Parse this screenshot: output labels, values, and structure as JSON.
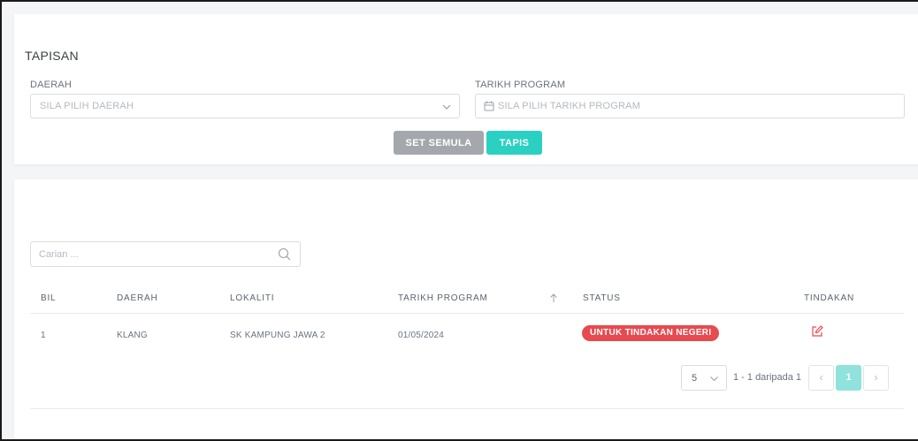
{
  "filter": {
    "title": "TAPISAN",
    "daerah_label": "DAERAH",
    "daerah_placeholder": "SILA PILIH DAERAH",
    "tarikh_label": "TARIKH PROGRAM",
    "tarikh_placeholder": "SILA PILIH TARIKH PROGRAM",
    "reset_label": "SET SEMULA",
    "filter_label": "TAPIS"
  },
  "search": {
    "placeholder": "Carian ..."
  },
  "table": {
    "columns": [
      "BIL",
      "DAERAH",
      "LOKALITI",
      "TARIKH PROGRAM",
      "STATUS",
      "TINDAKAN"
    ],
    "rows": [
      {
        "bil": "1",
        "daerah": "KLANG",
        "lokaliti": "SK KAMPUNG JAWA 2",
        "tarikh_program": "01/05/2024",
        "status": "UNTUK TINDAKAN NEGERI"
      }
    ]
  },
  "pagination": {
    "page_size": "5",
    "info": "1 - 1 daripada 1",
    "prev": "‹",
    "current_page": "1",
    "next": "›"
  },
  "colors": {
    "accent": "#2ad1c2",
    "reset_button": "#a4a7ab",
    "status_badge": "#e84a4f",
    "edit_icon": "#e84a4f"
  },
  "icons": {
    "select_chevron": "chevron-down-icon",
    "date_field": "calendar-icon",
    "search": "search-icon",
    "sort": "arrow-up-icon",
    "action": "edit-icon"
  }
}
